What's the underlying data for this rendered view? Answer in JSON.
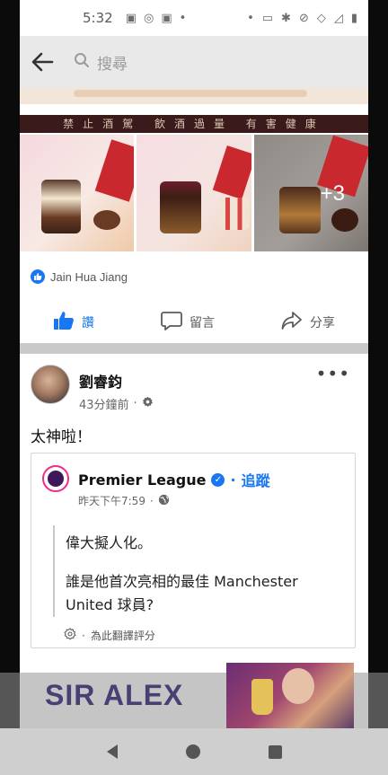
{
  "status_bar": {
    "time": "5:32"
  },
  "topbar": {
    "search_placeholder": "搜尋"
  },
  "post1": {
    "banner_text": "禁止酒駕 飲酒過量 有害健康",
    "more_photos_label": "+3",
    "liked_by": "Jain Hua Jiang",
    "actions": {
      "like": "讚",
      "comment": "留言",
      "share": "分享"
    }
  },
  "post2": {
    "author": "劉睿鈞",
    "time": "43分鐘前",
    "text": "太神啦！",
    "shared": {
      "page_name": "Premier League",
      "follow_label": "追蹤",
      "time": "昨天下午7:59",
      "quote_line1": "偉大擬人化。",
      "quote_line2": "誰是他首次亮相的最佳 Manchester United 球員?",
      "translate_label": "為此翻譯評分"
    }
  },
  "bottom_overlay": {
    "title": "SIR ALEX"
  },
  "colors": {
    "accent": "#1877f2",
    "premier_league": "#3d195b",
    "premier_ring": "#f02b8a"
  }
}
